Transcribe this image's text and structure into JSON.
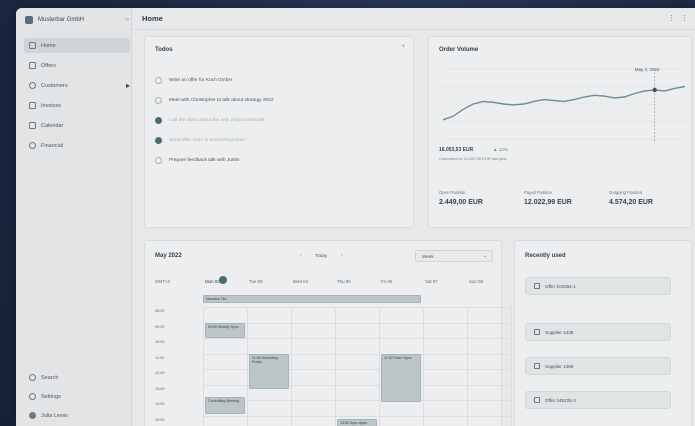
{
  "sidebar": {
    "workspace": "Musterbar GmbH",
    "items": [
      {
        "label": "Home",
        "icon": "home-icon",
        "active": true
      },
      {
        "label": "Offers",
        "icon": "document-icon"
      },
      {
        "label": "Customers",
        "icon": "people-icon"
      },
      {
        "label": "Invoices",
        "icon": "invoice-icon"
      },
      {
        "label": "Calendar",
        "icon": "calendar-icon"
      },
      {
        "label": "Financial",
        "icon": "coin-icon"
      }
    ],
    "bottom": [
      {
        "label": "Search",
        "icon": "search-icon"
      },
      {
        "label": "Settings",
        "icon": "gear-icon"
      },
      {
        "label": "Julia Lewis",
        "icon": "user-icon"
      }
    ]
  },
  "header": {
    "title": "Home"
  },
  "todos": {
    "title": "Todos",
    "items": [
      {
        "text": "Write an offer for Koch GmbH",
        "done": false
      },
      {
        "text": "Meet with Christopher to talk about strategy 2022",
        "done": false
      },
      {
        "text": "Call the client about the new project estimate",
        "done": true
      },
      {
        "text": "Send offer 1021 to accounting team",
        "done": true
      },
      {
        "text": "Prepare feedback talk with Justin",
        "done": false
      }
    ]
  },
  "order_volume": {
    "title": "Order Volume",
    "tooltip": "May 3, 2022",
    "total": "16.053,53 EUR",
    "change": "▲ 12%",
    "compare": "Compared to 14.022,45 EUR last year",
    "kpis": [
      {
        "label": "Open Position",
        "value": "2.449,00 EUR"
      },
      {
        "label": "Payed Position",
        "value": "12.022,99 EUR"
      },
      {
        "label": "Outgoing Position",
        "value": "4.574,20 EUR"
      }
    ]
  },
  "chart_data": {
    "type": "line",
    "x": [
      0,
      1,
      2,
      3,
      4,
      5,
      6,
      7,
      8,
      9,
      10,
      11,
      12,
      13,
      14,
      15,
      16,
      17,
      18,
      19,
      20,
      21,
      22,
      23,
      24
    ],
    "series": [
      {
        "values": [
          22,
          26,
          34,
          40,
          43,
          42,
          40,
          39,
          40,
          43,
          45,
          44,
          43,
          45,
          48,
          50,
          49,
          47,
          48,
          52,
          55,
          56,
          55,
          58,
          60
        ]
      }
    ],
    "ylim": [
      0,
      80
    ],
    "grid": true,
    "highlight_index": 21
  },
  "calendar": {
    "title": "May 2022",
    "today_label": "Today",
    "view_label": "Week",
    "tz": "GMT+2",
    "days": [
      "Mon 02",
      "Tue 03",
      "Wed 04",
      "Thu 05",
      "Fri 06",
      "Sat 07",
      "Sun 08"
    ],
    "allday_event": "Vacation Tim",
    "hours": [
      "08:00",
      "09:00",
      "10:00",
      "11:00",
      "12:00",
      "13:00",
      "14:00",
      "15:00"
    ],
    "events": [
      {
        "title": "09:00 Weekly Sync",
        "day": 0,
        "start": 1.0,
        "dur": 1.0
      },
      {
        "title": "11:00 Workshop Rocky",
        "day": 1,
        "start": 3.0,
        "dur": 2.3
      },
      {
        "title": "11:00 Team Sync",
        "day": 4,
        "start": 3.0,
        "dur": 3.1
      },
      {
        "title": "Controlling Meeting",
        "day": 0,
        "start": 5.8,
        "dur": 1.1
      },
      {
        "title": "15:00 Sync Apps",
        "day": 3,
        "start": 7.2,
        "dur": 1.0
      }
    ]
  },
  "recent": {
    "title": "Recently used",
    "items": [
      "Offer 103264-1",
      "Supplier 1336",
      "Supplier 1366",
      "Offer 245225-3"
    ]
  }
}
